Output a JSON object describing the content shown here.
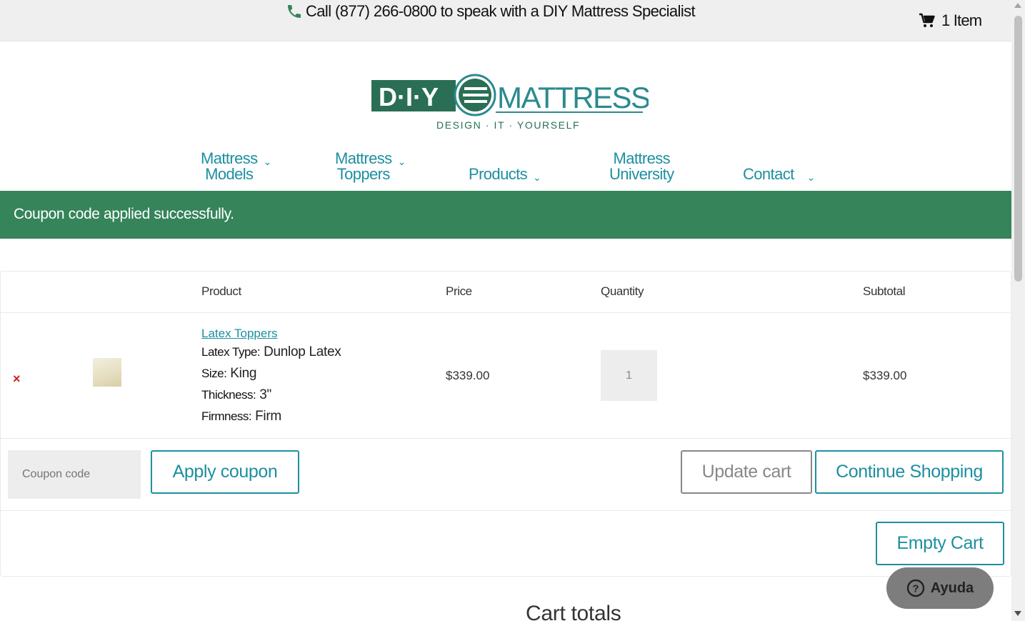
{
  "topbar": {
    "phone_text": "Call (877) 266-0800 to speak with a DIY Mattress Specialist",
    "cart_count": "1 Item"
  },
  "logo": {
    "brand_left": "D·I·Y",
    "brand_right": "MATTRESS",
    "tagline": "DESIGN · IT · YOURSELF",
    "colors": {
      "primary": "#2a8a8f",
      "dark": "#2a6f55"
    }
  },
  "nav": [
    {
      "line1": "Mattress",
      "line2": "Models",
      "has_dropdown": true
    },
    {
      "line1": "Mattress",
      "line2": "Toppers",
      "has_dropdown": true
    },
    {
      "line1": "",
      "line2": "Products",
      "has_dropdown": true
    },
    {
      "line1": "Mattress",
      "line2": "University",
      "has_dropdown": false
    },
    {
      "line1": "",
      "line2": "Contact",
      "has_dropdown": true
    }
  ],
  "notice": {
    "text": "Coupon code applied successfully.",
    "color": "#35845a"
  },
  "table": {
    "headers": {
      "product": "Product",
      "price": "Price",
      "quantity": "Quantity",
      "subtotal": "Subtotal"
    },
    "rows": [
      {
        "remove": "×",
        "product_link": "Latex Toppers",
        "attributes": [
          {
            "label": "Latex Type:",
            "value": "Dunlop Latex"
          },
          {
            "label": "Size:",
            "value": "King"
          },
          {
            "label": "Thickness:",
            "value": "3\""
          },
          {
            "label": "Firmness:",
            "value": "Firm"
          }
        ],
        "price": "$339.00",
        "quantity": "1",
        "subtotal": "$339.00"
      }
    ]
  },
  "actions": {
    "coupon_placeholder": "Coupon code",
    "apply_coupon": "Apply coupon",
    "update_cart": "Update cart",
    "continue_shopping": "Continue Shopping",
    "empty_cart": "Empty Cart"
  },
  "cart_totals": {
    "heading": "Cart totals"
  },
  "help": {
    "label": "Ayuda",
    "icon": "question-circle-icon"
  }
}
